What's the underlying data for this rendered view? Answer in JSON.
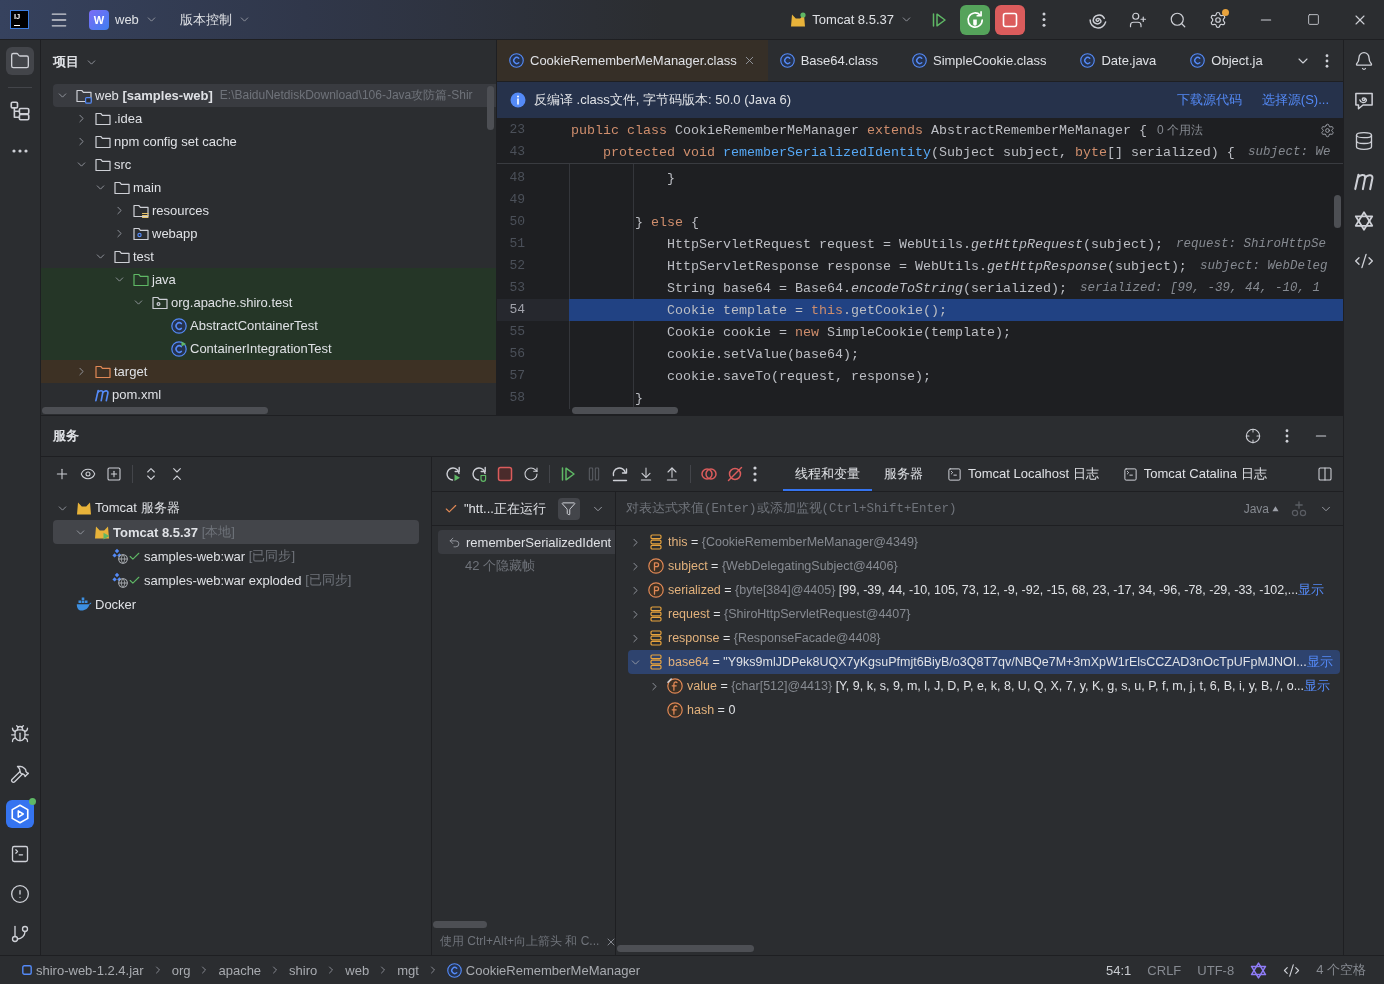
{
  "title_bar": {
    "logo": "IJ",
    "project": {
      "badge": "W",
      "name": "web"
    },
    "vcs": "版本控制",
    "run_config": "Tomcat 8.5.37",
    "run_config_running": true,
    "settings_badge": true
  },
  "left_toolbar": {
    "top": [
      {
        "selected": true
      },
      {
        "selected": false
      },
      {
        "selected": false
      }
    ],
    "bottom": [
      {
        "selected": false
      },
      {
        "selected": false
      },
      {
        "selected": true,
        "badge": true
      },
      {
        "selected": false
      },
      {
        "selected": false
      },
      {
        "selected": false
      }
    ]
  },
  "project_panel": {
    "title": "项目",
    "tree": [
      {
        "kind": "module",
        "name": "web",
        "module": "[samples-web]",
        "path": "E:\\BaiduNetdiskDownload\\106-Java攻防篇-Shir",
        "expanded": true,
        "selected": true,
        "children": [
          {
            "kind": "folder",
            "name": ".idea",
            "expanded": false,
            "selected": false
          },
          {
            "kind": "folder",
            "name": "npm config set cache",
            "expanded": false,
            "selected": false
          },
          {
            "kind": "folder",
            "name": "src",
            "expanded": true,
            "selected": false,
            "children": [
              {
                "kind": "folder",
                "name": "main",
                "expanded": true,
                "selected": false,
                "children": [
                  {
                    "kind": "resources",
                    "name": "resources",
                    "expanded": false,
                    "selected": false
                  },
                  {
                    "kind": "web",
                    "name": "webapp",
                    "expanded": false,
                    "selected": false
                  }
                ]
              },
              {
                "kind": "folder",
                "name": "test",
                "expanded": true,
                "selected": false,
                "children": [
                  {
                    "kind": "test-sources",
                    "name": "java",
                    "expanded": true,
                    "selected": false,
                    "children": [
                      {
                        "kind": "package",
                        "name": "org.apache.shiro.test",
                        "expanded": true,
                        "selected": false,
                        "children": [
                          {
                            "kind": "class",
                            "name": "AbstractContainerTest",
                            "selected": false
                          },
                          {
                            "kind": "runnable-class",
                            "name": "ContainerIntegrationTest",
                            "selected": false
                          }
                        ]
                      }
                    ]
                  }
                ]
              }
            ]
          },
          {
            "kind": "excluded",
            "name": "target",
            "expanded": false,
            "selected": false
          },
          {
            "kind": "maven",
            "name": "pom.xml",
            "selected": false
          }
        ]
      }
    ]
  },
  "editor": {
    "tabs": [
      {
        "label": "CookieRememberMeManager.class",
        "selected": true
      },
      {
        "label": "Base64.class",
        "selected": false
      },
      {
        "label": "SimpleCookie.class",
        "selected": false
      },
      {
        "label": "Date.java",
        "selected": false
      },
      {
        "label": "Object.ja",
        "selected": false
      }
    ],
    "banner": {
      "message": "反编译 .class文件, 字节码版本: 50.0 (Java 6)",
      "actions": [
        "下载源代码",
        "选择源(S)..."
      ]
    },
    "sticky_lines": [
      {
        "number": "23",
        "tokens": [
          {
            "kind": "keyword",
            "text": "public class"
          },
          {
            "kind": "plain",
            "text": " CookieRememberMeManager "
          },
          {
            "kind": "keyword",
            "text": "extends"
          },
          {
            "kind": "plain",
            "text": " AbstractRememberMeManager {"
          }
        ],
        "hint": {
          "kind": "usages",
          "text": "0 个用法"
        }
      },
      {
        "number": "43",
        "tokens": [
          {
            "kind": "keyword",
            "text": "    protected void "
          },
          {
            "kind": "declaration",
            "text": "rememberSerializedIdentity"
          },
          {
            "kind": "plain",
            "text": "(Subject subject, "
          },
          {
            "kind": "keyword",
            "text": "byte"
          },
          {
            "kind": "plain",
            "text": "[] serialized) {"
          }
        ],
        "hint": {
          "kind": "value",
          "text": "subject: We"
        }
      }
    ],
    "lines": [
      {
        "number": "48",
        "current": false,
        "tokens": [
          {
            "kind": "plain",
            "text": "            }"
          }
        ]
      },
      {
        "number": "49",
        "current": false
      },
      {
        "number": "50",
        "current": false,
        "tokens": [
          {
            "kind": "plain",
            "text": "        } "
          },
          {
            "kind": "keyword",
            "text": "else"
          },
          {
            "kind": "plain",
            "text": " {"
          }
        ]
      },
      {
        "number": "51",
        "current": false,
        "tokens": [
          {
            "kind": "plain",
            "text": "            HttpServletRequest request = WebUtils."
          },
          {
            "kind": "static",
            "text": "getHttpRequest"
          },
          {
            "kind": "plain",
            "text": "(subject);"
          }
        ],
        "hint": {
          "kind": "value",
          "text": "request: ShiroHttpSe"
        }
      },
      {
        "number": "52",
        "current": false,
        "tokens": [
          {
            "kind": "plain",
            "text": "            HttpServletResponse response = WebUtils."
          },
          {
            "kind": "static",
            "text": "getHttpResponse"
          },
          {
            "kind": "plain",
            "text": "(subject);"
          }
        ],
        "hint": {
          "kind": "value",
          "text": "subject: WebDeleg"
        }
      },
      {
        "number": "53",
        "current": false,
        "tokens": [
          {
            "kind": "plain",
            "text": "            String base64 = Base64."
          },
          {
            "kind": "static",
            "text": "encodeToString"
          },
          {
            "kind": "plain",
            "text": "(serialized);"
          }
        ],
        "hint": {
          "kind": "value",
          "text": "serialized: [99, -39, 44, -10, 1"
        }
      },
      {
        "number": "54",
        "current": true,
        "tokens": [
          {
            "kind": "plain",
            "text": "            Cookie template = "
          },
          {
            "kind": "keyword",
            "text": "this"
          },
          {
            "kind": "plain",
            "text": ".getCookie();"
          }
        ]
      },
      {
        "number": "55",
        "current": false,
        "tokens": [
          {
            "kind": "plain",
            "text": "            Cookie cookie = "
          },
          {
            "kind": "keyword",
            "text": "new"
          },
          {
            "kind": "plain",
            "text": " SimpleCookie(template);"
          }
        ]
      },
      {
        "number": "56",
        "current": false,
        "tokens": [
          {
            "kind": "plain",
            "text": "            cookie.setValue(base64);"
          }
        ]
      },
      {
        "number": "57",
        "current": false,
        "tokens": [
          {
            "kind": "plain",
            "text": "            cookie.saveTo(request, response);"
          }
        ]
      },
      {
        "number": "58",
        "current": false,
        "tokens": [
          {
            "kind": "plain",
            "text": "        }"
          }
        ]
      }
    ]
  },
  "services_panel": {
    "title": "服务",
    "tree": [
      {
        "kind": "server-group",
        "name": "Tomcat 服务器",
        "expanded": true,
        "selected": false,
        "children": [
          {
            "kind": "server",
            "name": "Tomcat 8.5.37",
            "status": "[本地]",
            "expanded": true,
            "selected": true,
            "children": [
              {
                "kind": "artifact",
                "name": "samples-web:war",
                "status": "[已同步]",
                "selected": false
              },
              {
                "kind": "artifact",
                "name": "samples-web:war exploded",
                "status": "[已同步]",
                "selected": false
              }
            ]
          }
        ]
      },
      {
        "kind": "docker",
        "name": "Docker",
        "selected": false
      }
    ],
    "debugger": {
      "toolbar": [
        {
          "disabled": false
        },
        {
          "disabled": false
        },
        {
          "disabled": false
        },
        {
          "disabled": false
        },
        {
          "disabled": false
        },
        {
          "disabled": true
        },
        {
          "disabled": false
        },
        {
          "disabled": false
        },
        {
          "disabled": false
        },
        {
          "disabled": false
        },
        {
          "disabled": false
        },
        {
          "disabled": false
        }
      ],
      "tabs": [
        {
          "kind": "plain",
          "label": "线程和变量",
          "selected": true
        },
        {
          "kind": "plain",
          "label": "服务器",
          "selected": false
        },
        {
          "kind": "console",
          "label": "Tomcat Localhost 日志",
          "selected": false
        },
        {
          "kind": "console",
          "label": "Tomcat Catalina 日志",
          "selected": false
        }
      ],
      "thread": {
        "label": "\"htt...正在运行",
        "filter_on": true
      },
      "frames": [
        {
          "label": "rememberSerializedIdent",
          "selected": true
        }
      ],
      "hidden_frames": "42 个隐藏帧",
      "frames_hint": "使用 Ctrl+Alt+向上箭头 和 C...",
      "evaluate": {
        "placeholder": "对表达式求值(Enter)或添加监视(Ctrl+Shift+Enter)",
        "language": "Java"
      },
      "variables": [
        {
          "kind": "local",
          "name": "this",
          "operator": "=",
          "type": "{CookieRememberMeManager@4349}",
          "expanded": false,
          "selected": false
        },
        {
          "kind": "parameter",
          "name": "subject",
          "operator": "=",
          "type": "{WebDelegatingSubject@4406}",
          "expanded": false,
          "selected": false
        },
        {
          "kind": "parameter",
          "name": "serialized",
          "operator": "=",
          "type": "{byte[384]@4405}",
          "value": "[99, -39, 44, -10, 105, 73, 12, -9, -92, -15, 68, 23, -17, 34, -96, -78, -29, -33, -102,...",
          "more": "显示",
          "expanded": false,
          "selected": false
        },
        {
          "kind": "local",
          "name": "request",
          "operator": "=",
          "type": "{ShiroHttpServletRequest@4407}",
          "expanded": false,
          "selected": false
        },
        {
          "kind": "local",
          "name": "response",
          "operator": "=",
          "type": "{ResponseFacade@4408}",
          "expanded": false,
          "selected": false
        },
        {
          "kind": "local",
          "name": "base64",
          "operator": "=",
          "value": "\"Y9ks9mlJDPek8UQX7yKgsuPfmjt6BiyB/o3Q8T7qv/NBQe7M+3mXpW1rElsCCZAD3nOcTpUFpMJNOI...",
          "more": "显示",
          "expanded": true,
          "selected": true,
          "children": [
            {
              "kind": "final-field",
              "name": "value",
              "operator": "=",
              "type": "{char[512]@4413}",
              "value": "[Y, 9, k, s, 9, m, l, J, D, P, e, k, 8, U, Q, X, 7, y, K, g, s, u, P, f, m, j, t, 6, B, i, y, B, /, o...",
              "more": "显示",
              "expanded": false,
              "selected": false
            },
            {
              "kind": "field",
              "name": "hash",
              "operator": "=",
              "value": "0",
              "selected": false
            }
          ]
        }
      ]
    }
  },
  "status_bar": {
    "breadcrumbs": [
      {
        "kind": "jar",
        "label": "shiro-web-1.2.4.jar"
      },
      {
        "kind": "package",
        "label": "org"
      },
      {
        "kind": "package",
        "label": "apache"
      },
      {
        "kind": "package",
        "label": "shiro"
      },
      {
        "kind": "package",
        "label": "web"
      },
      {
        "kind": "package",
        "label": "mgt"
      },
      {
        "kind": "class",
        "label": "CookieRememberMeManager"
      }
    ],
    "position": "54:1",
    "line_separator": "CRLF",
    "encoding": "UTF-8",
    "indent": "4 个空格"
  }
}
